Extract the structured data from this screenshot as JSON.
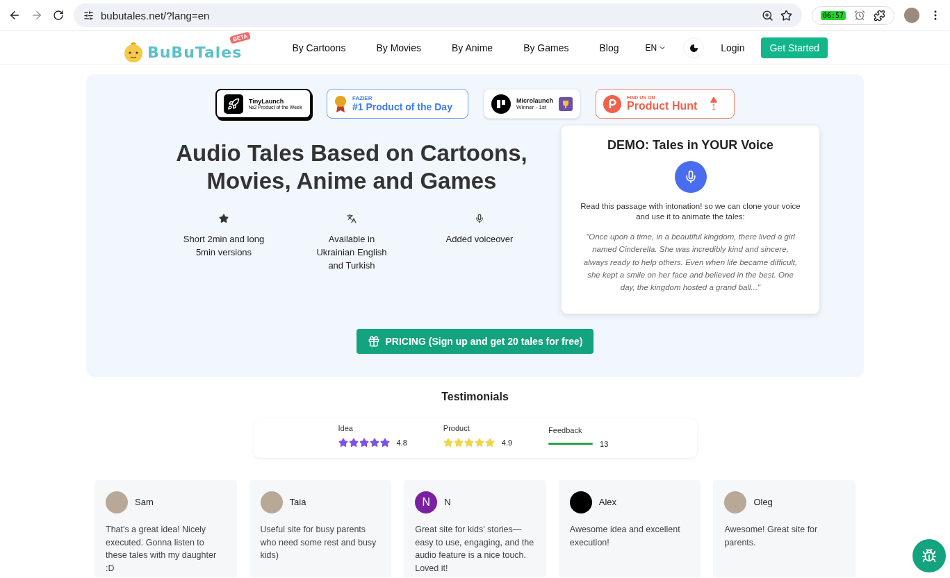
{
  "browser": {
    "url": "bubutales.net/?lang=en",
    "extension_badge": "06:57"
  },
  "nav": {
    "logo": "BuBuTales",
    "logo_badge": "BETA",
    "links": [
      "By Cartoons",
      "By Movies",
      "By Anime",
      "By Games",
      "Blog"
    ],
    "language": "EN",
    "login": "Login",
    "cta": "Get Started"
  },
  "badges": [
    {
      "kind": "tinylaunch",
      "title": "TinyLaunch",
      "subtitle": "№2 Product of the Week"
    },
    {
      "kind": "fazier",
      "subtitle": "FAZIER",
      "title": "#1 Product of the Day"
    },
    {
      "kind": "microlaunch",
      "title": "Microlaunch",
      "subtitle": "Winner - 1st"
    },
    {
      "kind": "producthunt",
      "subtitle": "FIND US ON",
      "title": "Product Hunt",
      "count": "1"
    }
  ],
  "hero": {
    "title": "Audio Tales Based on Cartoons, Movies, Anime and Games",
    "features": [
      {
        "kind": "star",
        "text": "Short 2min and long 5min versions"
      },
      {
        "kind": "language",
        "text": "Available in Ukrainian English and Turkish"
      },
      {
        "kind": "mic",
        "text": "Added voiceover"
      }
    ],
    "pricing_button": "PRICING (Sign up and get 20 tales for free)"
  },
  "demo": {
    "title": "DEMO: Tales in YOUR Voice",
    "instruction": "Read this passage with intonation! so we can clone your voice and use it to animate the tales:",
    "passage": "\"Once upon a time, in a beautiful kingdom, there lived a girl named Cinderella. She was incredibly kind and sincere, always ready to help others. Even when life became difficult, she kept a smile on her face and believed in the best. One day, the kingdom hosted a grand ball...\""
  },
  "testimonials": {
    "title": "Testimonials",
    "ratings": [
      {
        "kind": "stars",
        "label": "Idea",
        "stars": 5,
        "color": "#7b52e6",
        "value": "4.8"
      },
      {
        "kind": "stars",
        "label": "Product",
        "stars": 5,
        "color": "#f0d54a",
        "value": "4.9"
      },
      {
        "kind": "bar",
        "label": "Feedback",
        "level": 1,
        "value": "13"
      }
    ],
    "reviews": [
      {
        "name": "Sam",
        "kind": "photo",
        "text": "That's a great idea! Nicely executed. Gonna listen to these tales with my daughter :D"
      },
      {
        "name": "Taia",
        "kind": "photo",
        "text": "Useful site for busy parents who need some rest and busy kids)"
      },
      {
        "name": "N",
        "kind": "initial",
        "initial": "N",
        "text": "Great site for kids' stories—easy to use, engaging, and the audio feature is a nice touch. Loved it!"
      },
      {
        "name": "Alex",
        "kind": "plain",
        "text": "Awesome idea and excellent execution!"
      },
      {
        "name": "Oleg",
        "kind": "photo",
        "text": "Awesome! Great site for parents."
      }
    ]
  }
}
